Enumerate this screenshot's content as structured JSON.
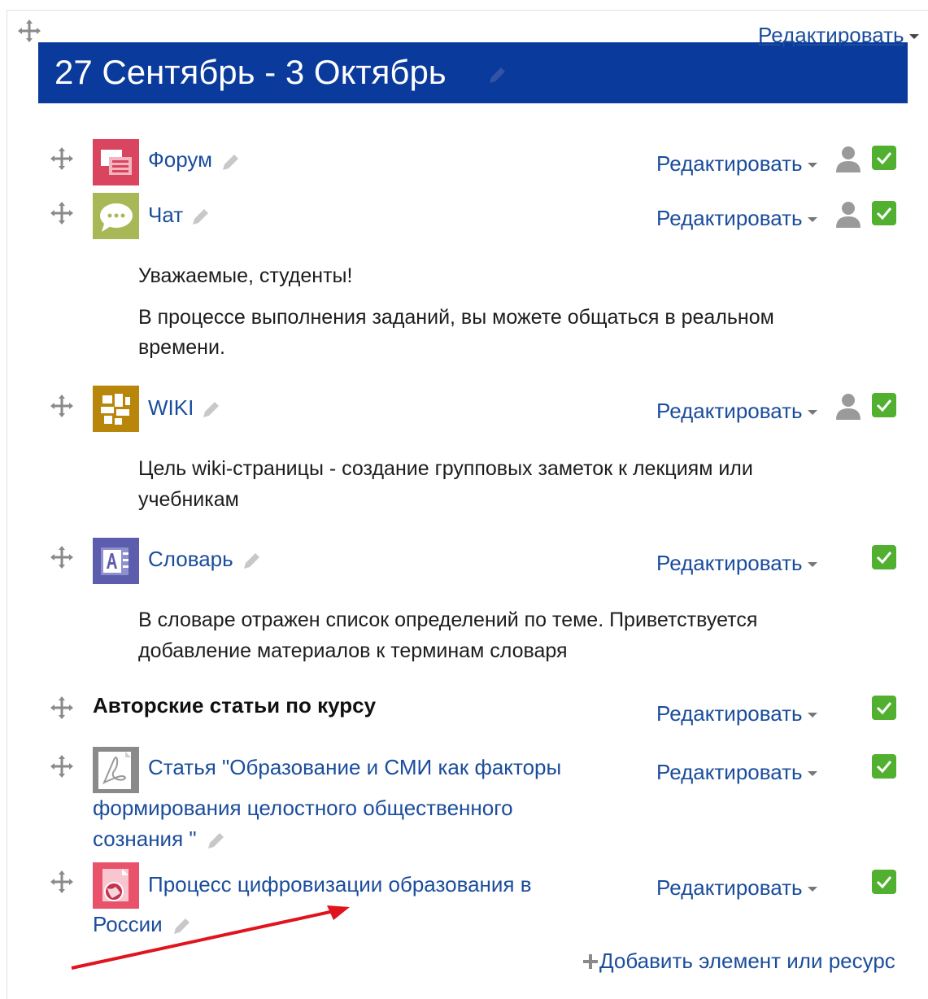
{
  "section": {
    "title": "27 Сентябрь - 3 Октябрь",
    "edit_label": "Редактировать",
    "banner_color": "#0a3a9c"
  },
  "activities": [
    {
      "name": "Форум",
      "type_icon": "forum-icon",
      "color": "#d9455f"
    },
    {
      "name": "Чат",
      "type_icon": "chat-icon",
      "color": "#a9b856"
    },
    {
      "name": "WIKI",
      "type_icon": "wiki-icon",
      "color": "#b8860b"
    },
    {
      "name": "Словарь",
      "type_icon": "glossary-icon",
      "color": "#5c5dac"
    }
  ],
  "descriptions": {
    "chat": [
      "Уважаемые, студенты!",
      "В процессе выполнения заданий, вы можете общаться в реальном",
      "времени."
    ],
    "wiki": [
      "Цель wiki-страницы - создание групповых заметок к лекциям или",
      "учебникам"
    ],
    "glossary": [
      "В словаре отражен список определений по теме. Приветствуется",
      "добавление материалов к терминам словаря"
    ]
  },
  "label": {
    "text": "Авторские статьи по курсу"
  },
  "resources": {
    "pdf_article": {
      "lines": [
        "Статья \"Образование и СМИ как факторы",
        "формирования целостного общественного",
        "сознания \""
      ],
      "type_icon": "pdf-icon"
    },
    "digitization": {
      "lines": [
        "Процесс цифровизации образования в",
        "России"
      ],
      "type_icon": "url-icon",
      "color": "#e8536b"
    }
  },
  "edit_label": "Редактировать",
  "add_resource_label": "Добавить элемент или ресурс",
  "accent_link_color": "#1b4d9c",
  "visibility_color": "#51b030",
  "annotation_arrow_color": "#e0141e"
}
